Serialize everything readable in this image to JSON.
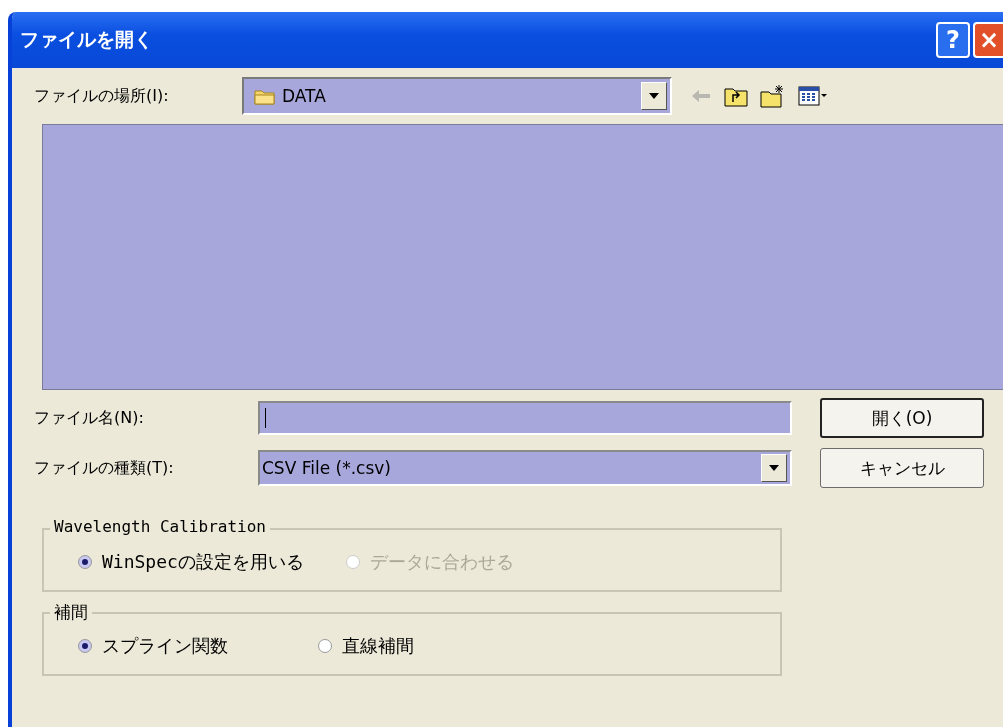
{
  "window": {
    "title": "ファイルを開く",
    "help_button": "?",
    "close_button": "×"
  },
  "location": {
    "label": "ファイルの場所(I):",
    "value": "DATA"
  },
  "filename": {
    "label": "ファイル名(N):"
  },
  "filetype": {
    "label": "ファイルの種類(T):",
    "value": "CSV File (*.csv)"
  },
  "buttons": [
    {
      "label": "開く(O)",
      "default": true
    },
    {
      "label": "キャンセル",
      "default": false
    }
  ],
  "groups": [
    {
      "title": "Wavelength Calibration",
      "options": [
        {
          "label": "WinSpecの設定を用いる",
          "selected": true,
          "disabled": false
        },
        {
          "label": "データに合わせる",
          "selected": false,
          "disabled": true
        }
      ]
    },
    {
      "title": "補間",
      "options": [
        {
          "label": "スプライン関数",
          "selected": true,
          "disabled": false
        },
        {
          "label": "直線補間",
          "selected": false,
          "disabled": false
        }
      ]
    }
  ]
}
